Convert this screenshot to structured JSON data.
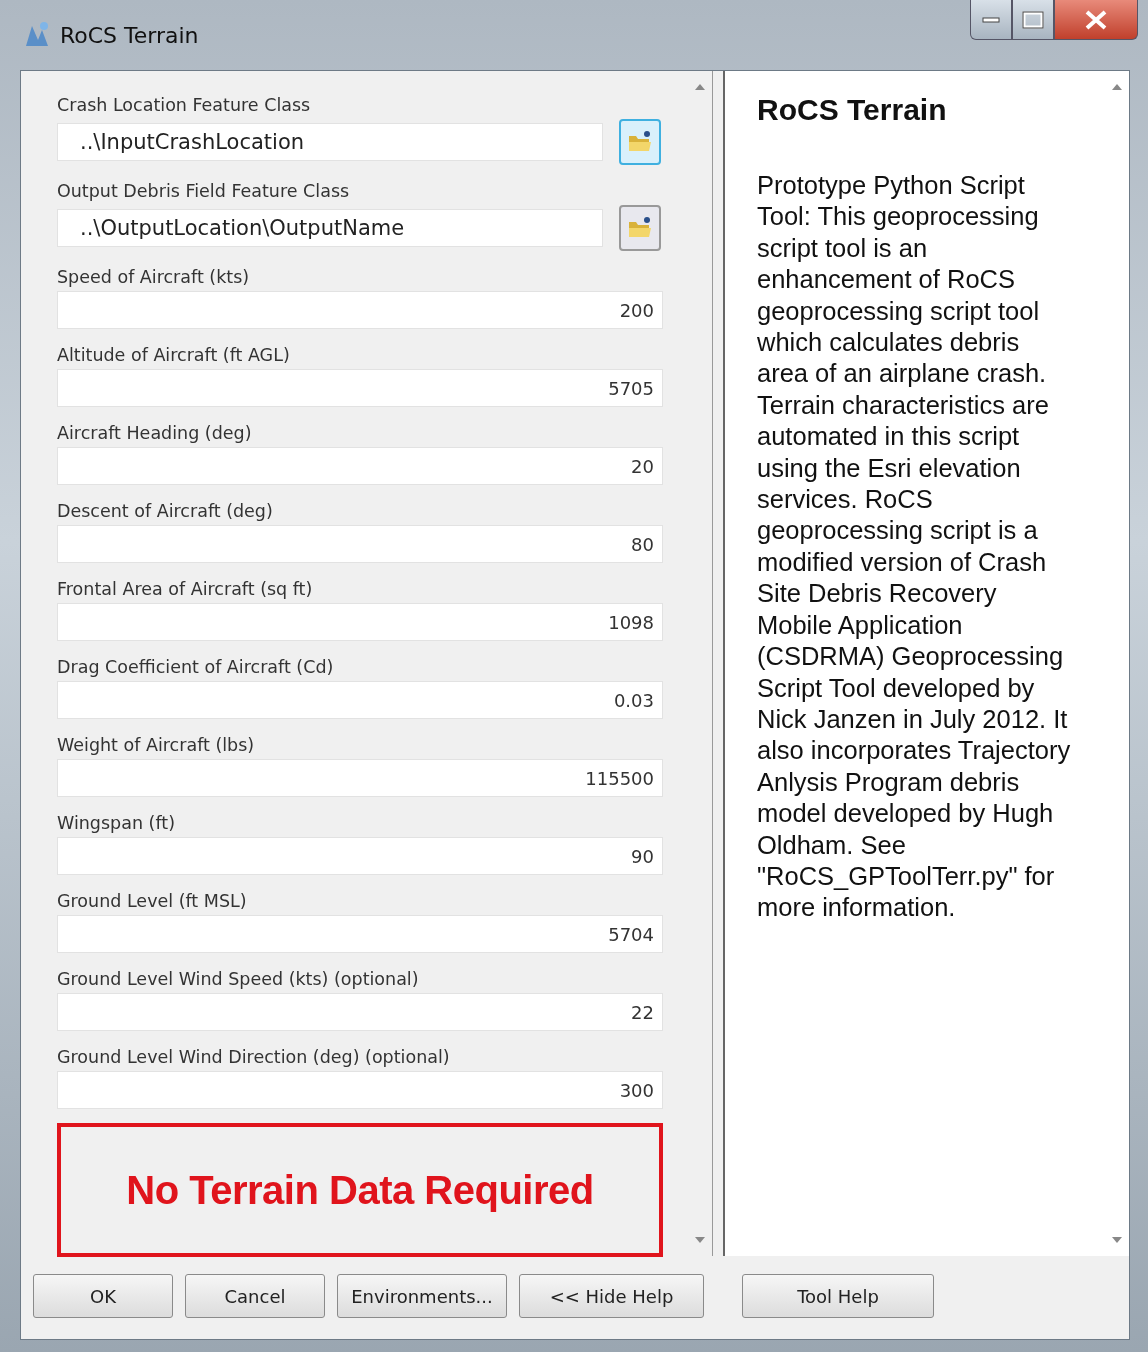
{
  "window": {
    "title": "RoCS Terrain"
  },
  "parameters": [
    {
      "kind": "path",
      "label": "Crash Location Feature Class",
      "value": "..\\InputCrashLocation",
      "browse_highlighted": true
    },
    {
      "kind": "path",
      "label": "Output Debris Field Feature Class",
      "value": "..\\OutputLocation\\OutputName",
      "browse_highlighted": false
    },
    {
      "kind": "number",
      "label": "Speed of Aircraft (kts)",
      "value": "200"
    },
    {
      "kind": "number",
      "label": "Altitude of Aircraft (ft AGL)",
      "value": "5705"
    },
    {
      "kind": "number",
      "label": "Aircraft Heading (deg)",
      "value": "20"
    },
    {
      "kind": "number",
      "label": "Descent of Aircraft (deg)",
      "value": "80"
    },
    {
      "kind": "number",
      "label": "Frontal Area of Aircraft (sq ft)",
      "value": "1098"
    },
    {
      "kind": "number",
      "label": "Drag Coefficient of Aircraft (Cd)",
      "value": "0.03"
    },
    {
      "kind": "number",
      "label": "Weight of Aircraft (lbs)",
      "value": "115500"
    },
    {
      "kind": "number",
      "label": "Wingspan (ft)",
      "value": "90"
    },
    {
      "kind": "number",
      "label": "Ground Level (ft MSL)",
      "value": "5704"
    },
    {
      "kind": "number",
      "label": "Ground Level Wind Speed (kts) (optional)",
      "value": "22"
    },
    {
      "kind": "number",
      "label": "Ground Level Wind Direction (deg) (optional)",
      "value": "300"
    }
  ],
  "notice": "No Terrain Data Required",
  "help": {
    "title": "RoCS Terrain",
    "text": "Prototype Python Script Tool: This geoprocessing script tool is an enhancement of RoCS geoprocessing script tool which calculates debris area of an airplane crash. Terrain characteristics are automated in this script using the Esri elevation services. RoCS geoprocessing script is a modified version of Crash Site Debris Recovery Mobile Application (CSDRMA) Geoprocessing Script Tool developed by Nick Janzen in July 2012. It also incorporates Trajectory Anlysis Program debris model developed by Hugh Oldham. See \"RoCS_GPToolTerr.py\" for more information."
  },
  "buttons": [
    {
      "label": "OK"
    },
    {
      "label": "Cancel"
    },
    {
      "label": "Environments..."
    },
    {
      "label": "<< Hide Help"
    }
  ],
  "help_button": {
    "label": "Tool Help"
  }
}
